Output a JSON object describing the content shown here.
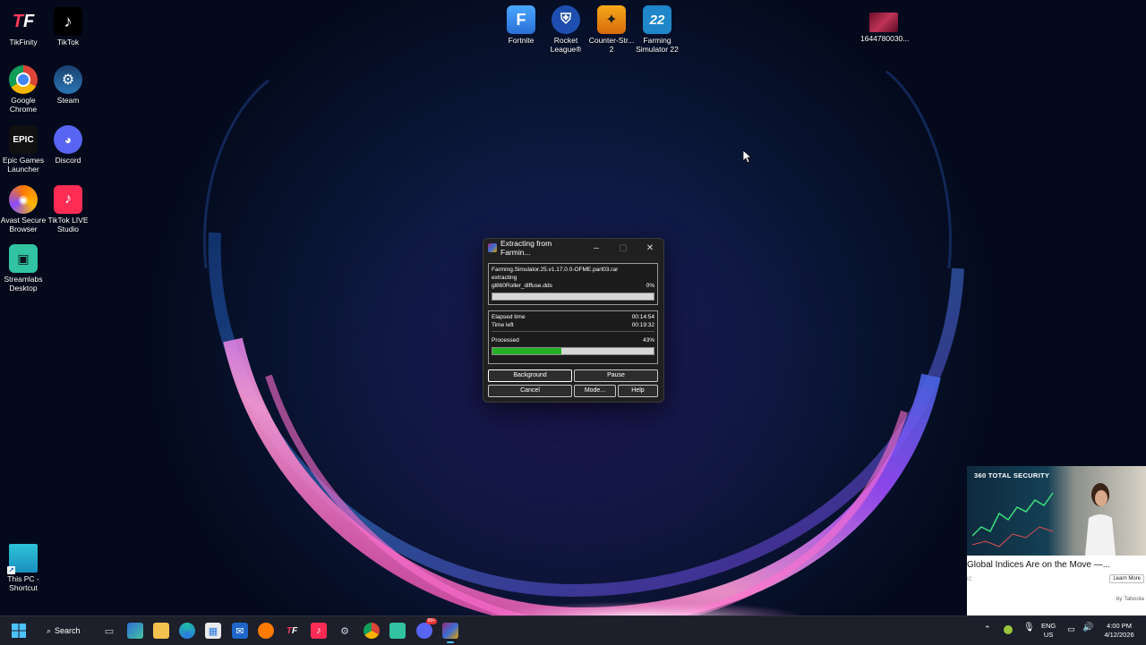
{
  "desktop": {
    "left_icons": [
      {
        "label": "TikFinity",
        "icon": "tikfinity-icon"
      },
      {
        "label": "TikTok",
        "icon": "tiktok-icon"
      },
      {
        "label": "Google Chrome",
        "icon": "chrome-icon"
      },
      {
        "label": "Steam",
        "icon": "steam-icon"
      },
      {
        "label": "Epic Games Launcher",
        "icon": "epic-games-icon"
      },
      {
        "label": "Discord",
        "icon": "discord-icon"
      },
      {
        "label": "Avast Secure Browser",
        "icon": "avast-icon"
      },
      {
        "label": "TikTok LIVE Studio",
        "icon": "tiktok-live-icon"
      },
      {
        "label": "Streamlabs Desktop",
        "icon": "streamlabs-icon"
      },
      {
        "label": "This PC - Shortcut",
        "icon": "this-pc-icon"
      }
    ],
    "top_icons": [
      {
        "label": "Fortnite",
        "icon": "fortnite-icon"
      },
      {
        "label": "Rocket League®",
        "icon": "rocket-league-icon"
      },
      {
        "label": "Counter-Str... 2",
        "icon": "counter-strike-icon"
      },
      {
        "label": "Farming Simulator 22",
        "icon": "farming-sim-icon"
      },
      {
        "label": "1644780030...",
        "icon": "image-file-icon"
      }
    ]
  },
  "dialog": {
    "title": "Extracting from Farmin...",
    "archive": "Farming.Simulator.25.v1.17.0.0-OFME.part03.rar",
    "action": "extracting",
    "current_file": "gl860Roller_diffuse.dds",
    "file_percent": "0%",
    "file_progress": 0,
    "elapsed_label": "Elapsed time",
    "elapsed_value": "00:14:54",
    "left_label": "Time left",
    "left_value": "00:19:32",
    "processed_label": "Processed",
    "processed_percent": "43%",
    "processed_progress": 0.43,
    "buttons": {
      "background": "Background",
      "pause": "Pause",
      "cancel": "Cancel",
      "mode": "Mode...",
      "help": "Help"
    }
  },
  "ad": {
    "brand": "360 TOTAL SECURITY",
    "headline": "Global Indices Are on the Move —...",
    "source": "IC",
    "cta": "Learn More",
    "provider": "by Taboola"
  },
  "taskbar": {
    "search_label": "Search",
    "apps": [
      "task-view-icon",
      "widgets-icon",
      "file-explorer-icon",
      "edge-icon",
      "store-icon",
      "mail-icon",
      "avast-icon",
      "tikfinity-icon",
      "tiktok-icon",
      "steam-icon",
      "chrome-icon",
      "streamlabs-icon",
      "discord-icon",
      "winrar-icon"
    ],
    "discord_badge": "99+",
    "lang": "ENG",
    "region": "US",
    "time": "4:00 PM",
    "date": "4/12/2026"
  }
}
